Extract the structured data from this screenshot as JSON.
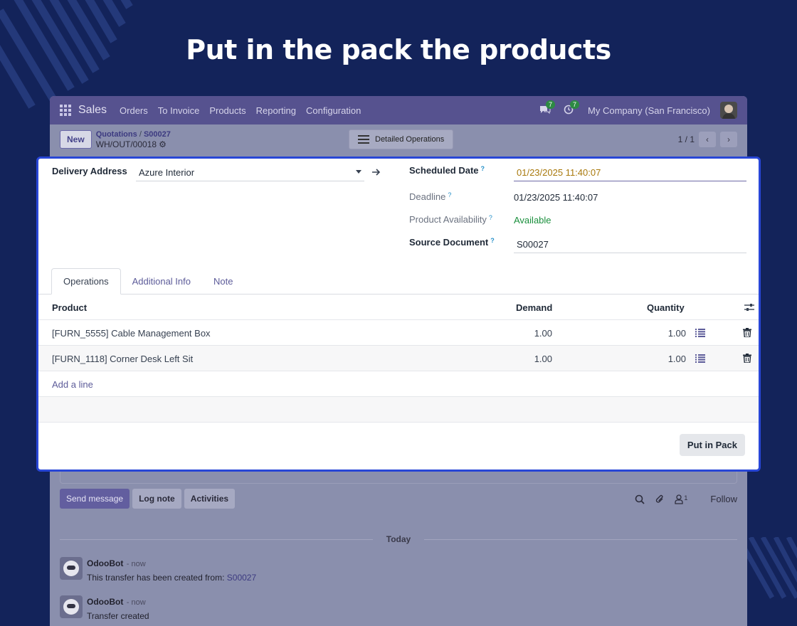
{
  "headline": "Put in the pack the products",
  "navbar": {
    "app_name": "Sales",
    "menu": [
      "Orders",
      "To Invoice",
      "Products",
      "Reporting",
      "Configuration"
    ],
    "messages_count": "7",
    "activities_count": "7",
    "company": "My Company (San Francisco)"
  },
  "controlbar": {
    "new_label": "New",
    "breadcrumb_parent": "Quotations",
    "breadcrumb_separator": "/",
    "breadcrumb_current": "S00027",
    "record_name": "WH/OUT/00018",
    "detailed_operations": "Detailed Operations",
    "pager": "1 / 1"
  },
  "form": {
    "delivery_address_label": "Delivery Address",
    "delivery_address_value": "Azure Interior",
    "scheduled_date_label": "Scheduled Date",
    "scheduled_date_value": "01/23/2025 11:40:07",
    "deadline_label": "Deadline",
    "deadline_value": "01/23/2025 11:40:07",
    "availability_label": "Product Availability",
    "availability_value": "Available",
    "source_document_label": "Source Document",
    "source_document_value": "S00027",
    "help_mark": "?"
  },
  "tabs": [
    "Operations",
    "Additional Info",
    "Note"
  ],
  "operations": {
    "columns": {
      "product": "Product",
      "demand": "Demand",
      "quantity": "Quantity"
    },
    "rows": [
      {
        "product": "[FURN_5555] Cable Management Box",
        "demand": "1.00",
        "quantity": "1.00"
      },
      {
        "product": "[FURN_1118] Corner Desk Left Sit",
        "demand": "1.00",
        "quantity": "1.00"
      }
    ],
    "add_line": "Add a line"
  },
  "put_in_pack": "Put in Pack",
  "chatter": {
    "send_message": "Send message",
    "log_note": "Log note",
    "activities": "Activities",
    "followers_count": "1",
    "follow": "Follow",
    "today": "Today",
    "messages": [
      {
        "author": "OdooBot",
        "time": "- now",
        "body_prefix": "This transfer has been created from: ",
        "body_ref": "S00027"
      },
      {
        "author": "OdooBot",
        "time": "- now",
        "body_prefix": "Transfer created",
        "body_ref": ""
      }
    ]
  },
  "colors": {
    "background": "#13235a",
    "highlight_border": "#2846d6",
    "navbar": "#56528f",
    "available_green": "#1a8f3c",
    "scheduled_date_text": "#a8780b",
    "link_purple": "#5c5b99"
  }
}
